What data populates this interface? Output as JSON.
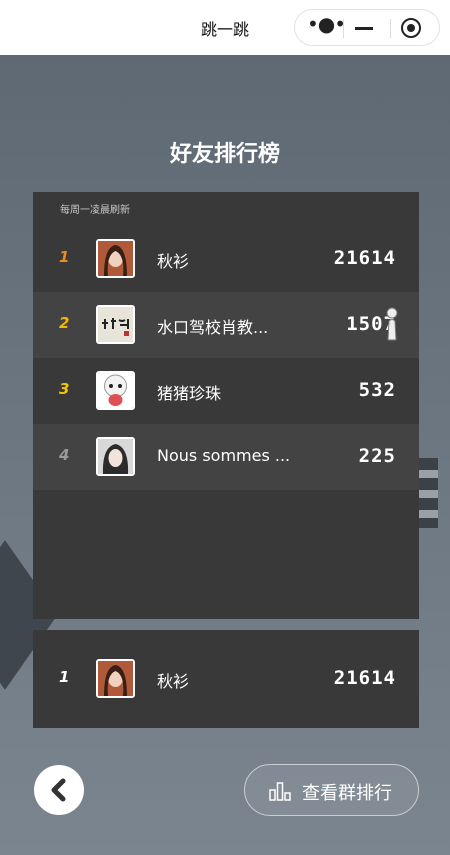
{
  "window": {
    "title": "跳一跳",
    "more_icon": "more-dots-icon",
    "minimize_icon": "minimize-icon",
    "close_icon": "record-close-icon"
  },
  "page": {
    "title": "好友排行榜",
    "refresh_note": "每周一凌晨刷新"
  },
  "leaderboard": [
    {
      "rank": "1",
      "rank_color": "#f08a1a",
      "name": "秋衫",
      "score": "21614",
      "avatar": "avatar-woman-photo"
    },
    {
      "rank": "2",
      "rank_color": "#f5b800",
      "name": "水口驾校肖教...",
      "score": "1507",
      "avatar": "avatar-calligraphy"
    },
    {
      "rank": "3",
      "rank_color": "#f5c400",
      "name": "猪猪珍珠",
      "score": "532",
      "avatar": "avatar-cartoon-sheep"
    },
    {
      "rank": "4",
      "rank_color": "#9a9a9a",
      "name": "Nous sommes ...",
      "score": "225",
      "avatar": "avatar-girl-photo"
    }
  ],
  "me": {
    "rank": "1",
    "name": "秋衫",
    "score": "21614"
  },
  "actions": {
    "back_icon": "chevron-left-icon",
    "group_icon": "bar-chart-icon",
    "group_label": "查看群排行"
  }
}
